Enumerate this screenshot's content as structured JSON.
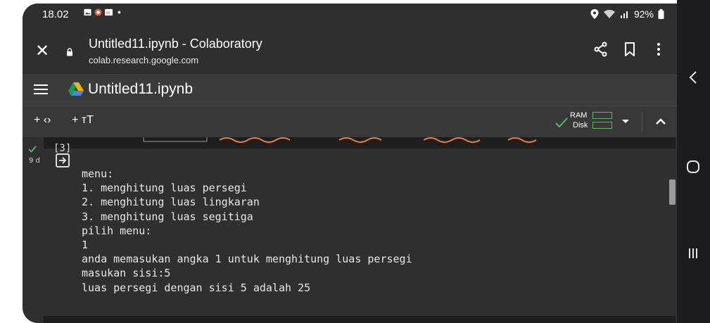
{
  "status_bar": {
    "time": "18.02",
    "battery": "92%",
    "icons": [
      "gallery-icon",
      "app-icon",
      "cs-icon",
      "dot-icon"
    ],
    "right_icons": [
      "location-icon",
      "wifi-icon",
      "signal-icon",
      "battery-icon"
    ]
  },
  "browser": {
    "page_title": "Untitled11.ipynb - Colaboratory",
    "url": "colab.research.google.com",
    "buttons": [
      "close-icon",
      "share-icon",
      "bookmark-icon",
      "more-icon"
    ]
  },
  "colab": {
    "notebook_title": "Untitled11.ipynb",
    "toolbar": {
      "add_code": "+ ‹›",
      "add_text": "+ тТ",
      "ram_label": "RAM",
      "disk_label": "Disk"
    },
    "cell": {
      "execution_count": "[3]",
      "runtime": "9 d",
      "output_lines": [
        "menu:",
        "1. menghitung luas persegi",
        "2. menghitung luas lingkaran",
        "3. menghitung luas segitiga",
        "pilih menu:",
        "1",
        "anda memasukan angka 1 untuk menghitung luas persegi",
        "masukan sisi:5",
        "luas persegi dengan sisi 5 adalah 25"
      ]
    }
  },
  "nav": {
    "icons": [
      "back-icon",
      "home-icon",
      "recents-icon"
    ]
  },
  "colors": {
    "accent_green": "#5fb75f",
    "code_orange": "#e87d3e",
    "background_dark": "#2f2f2f"
  }
}
